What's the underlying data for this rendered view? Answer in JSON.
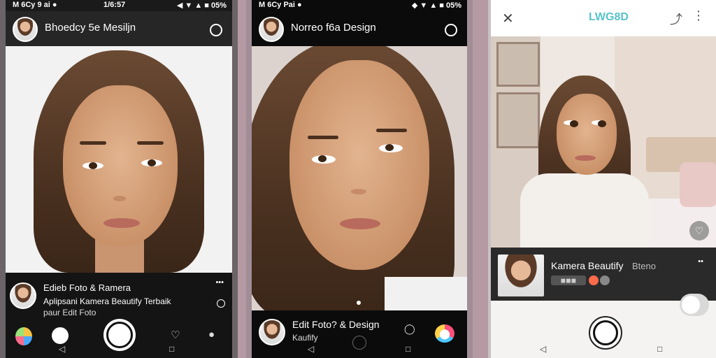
{
  "phone1": {
    "status": {
      "left": "M 6Cy 9 ai ●",
      "time": "1/6:57",
      "right": "◀ ▼ ▲ ■ 05%"
    },
    "header": {
      "title": "Bhoedcy 5e Mesiljn"
    },
    "info": {
      "title": "Edieb Foto & Ramera",
      "line1": "Aplipsani Kamera Beautify Terbaik",
      "line2": "paur Edit Foto",
      "more": "•••"
    },
    "nav": {
      "back": "◁",
      "home": "□"
    }
  },
  "phone2": {
    "status": {
      "left": "M 6Cy Pai ●",
      "right": "◆ ▼ ▲ ■ 05%"
    },
    "header": {
      "title": "Norreo f6a Design"
    },
    "info": {
      "title": "Edit Foto? & Design",
      "subtitle": "Kaufify"
    },
    "nav": {
      "back": "◁",
      "home": "□"
    }
  },
  "phone3": {
    "toolbar": {
      "logo": "LWG8D"
    },
    "card": {
      "title": "Kamera Beautify",
      "tag": "Bteno",
      "more": "••",
      "badge": "◼◼◼"
    },
    "nav": {
      "back": "◁",
      "home": "□"
    }
  },
  "colors": {
    "accent": "#ff6b4a",
    "brand_text": "#58c3c9",
    "bg_dark": "#111111",
    "frame": "#b59aa3"
  },
  "icons": [
    "close-icon",
    "share-icon",
    "more-vertical-icon",
    "heart-icon",
    "profile-icon",
    "camera-switch-icon",
    "color-palette-icon",
    "info-icon"
  ]
}
